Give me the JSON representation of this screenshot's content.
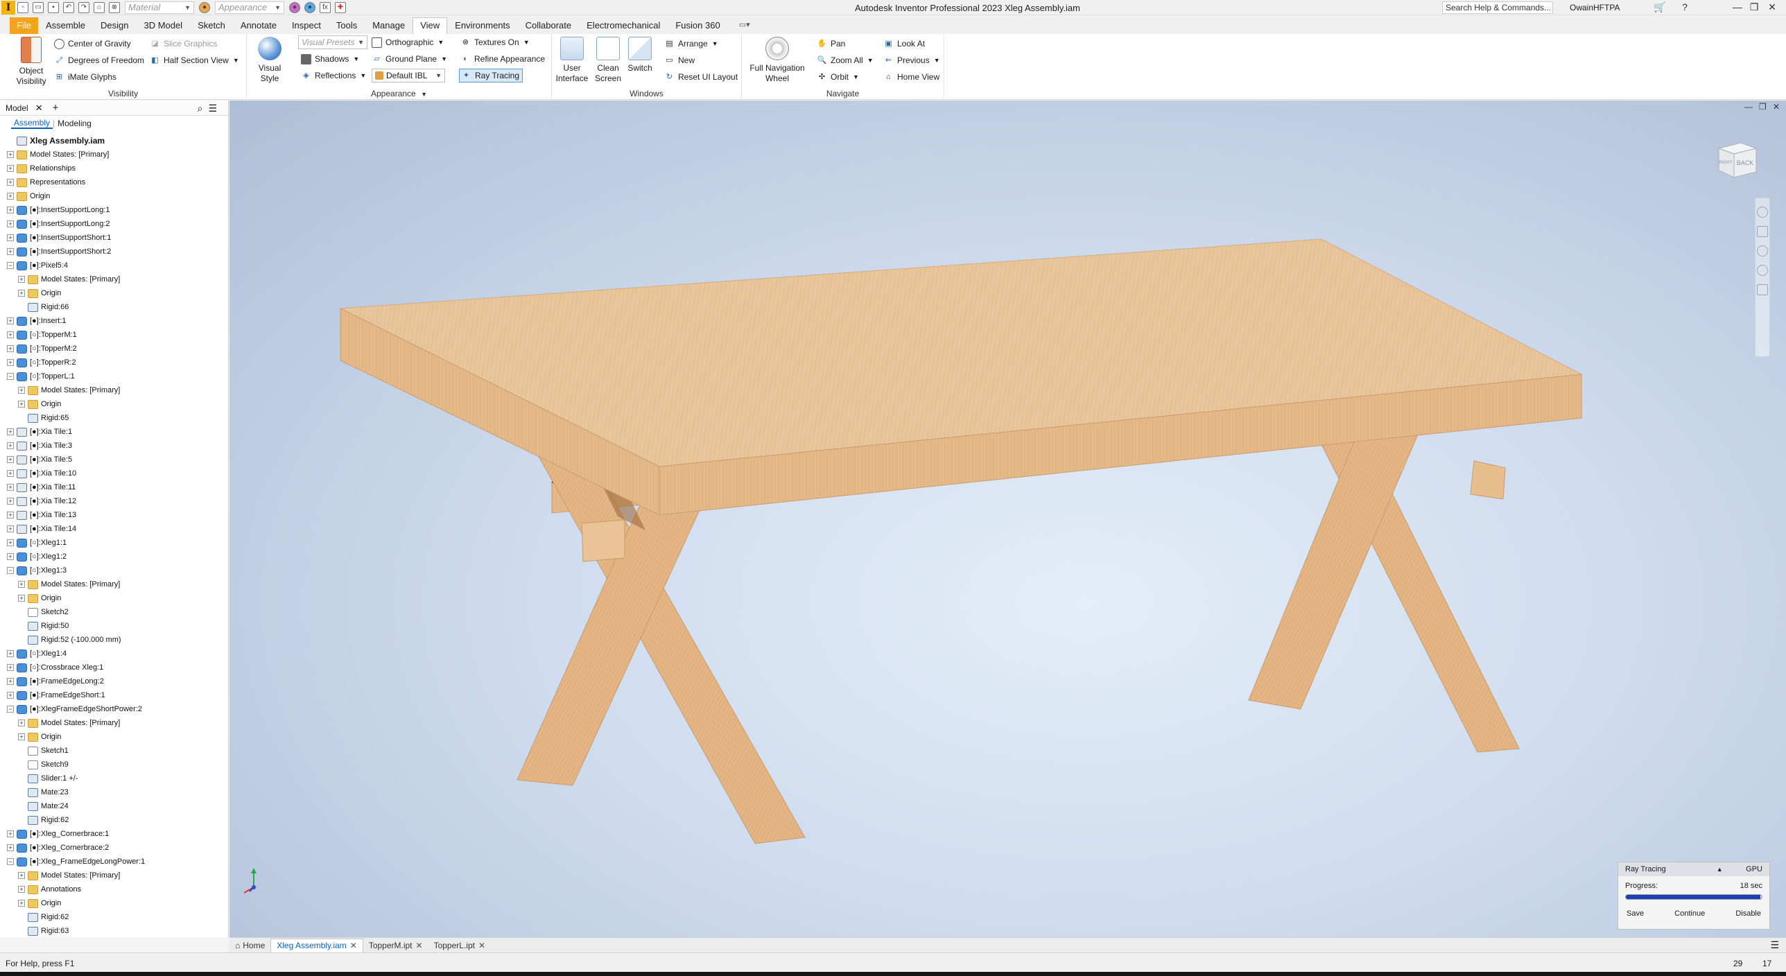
{
  "titlebar": {
    "app_logo": "I",
    "material_placeholder": "Material",
    "appearance_placeholder": "Appearance",
    "fx_label": "fx",
    "title": "Autodesk Inventor Professional 2023    Xleg Assembly.iam",
    "help_search": "Search Help & Commands...",
    "user": "OwainHFTPA"
  },
  "ribbon_tabs": [
    "File",
    "Assemble",
    "Design",
    "3D Model",
    "Sketch",
    "Annotate",
    "Inspect",
    "Tools",
    "Manage",
    "View",
    "Environments",
    "Collaborate",
    "Electromechanical",
    "Fusion 360"
  ],
  "active_tab": "View",
  "ribbon": {
    "visibility": {
      "title": "Visibility",
      "object_visibility": "Object Visibility",
      "center_of_gravity": "Center of Gravity",
      "degrees_of_freedom": "Degrees of Freedom",
      "imate_glyphs": "iMate Glyphs",
      "slice_graphics": "Slice Graphics",
      "half_section_view": "Half Section View"
    },
    "appearance": {
      "title": "Appearance",
      "visual_style": "Visual Style",
      "visual_presets": "Visual Presets",
      "orthographic": "Orthographic",
      "shadows": "Shadows",
      "ground_plane": "Ground Plane",
      "reflections": "Reflections",
      "default_ibl": "Default IBL",
      "textures_on": "Textures On",
      "refine_appearance": "Refine Appearance",
      "ray_tracing": "Ray Tracing"
    },
    "windows": {
      "title": "Windows",
      "user_interface": "User Interface",
      "clean_screen": "Clean Screen",
      "switch": "Switch",
      "arrange": "Arrange",
      "new": "New",
      "reset_ui_layout": "Reset UI Layout"
    },
    "navigate": {
      "title": "Navigate",
      "full_navigation_wheel": "Full Navigation Wheel",
      "pan": "Pan",
      "zoom_all": "Zoom All",
      "orbit": "Orbit",
      "look_at": "Look At",
      "previous": "Previous",
      "home_view": "Home View"
    }
  },
  "browser": {
    "title": "Model",
    "subtabs": [
      "Assembly",
      "Modeling"
    ],
    "tree": [
      {
        "label": "Xleg Assembly.iam",
        "level": 0,
        "icon": "asm",
        "exp": "",
        "root": true
      },
      {
        "label": "Model States: [Primary]",
        "level": 0,
        "icon": "folder",
        "exp": "+"
      },
      {
        "label": "Relationships",
        "level": 0,
        "icon": "rel",
        "exp": "+"
      },
      {
        "label": "Representations",
        "level": 0,
        "icon": "folder",
        "exp": "+"
      },
      {
        "label": "Origin",
        "level": 0,
        "icon": "folder",
        "exp": "+"
      },
      {
        "label": "[●]:InsertSupportLong:1",
        "level": 0,
        "icon": "part",
        "exp": "+"
      },
      {
        "label": "[●]:InsertSupportLong:2",
        "level": 0,
        "icon": "part",
        "exp": "+"
      },
      {
        "label": "[●]:InsertSupportShort:1",
        "level": 0,
        "icon": "part",
        "exp": "+"
      },
      {
        "label": "[●]:InsertSupportShort:2",
        "level": 0,
        "icon": "part",
        "exp": "+"
      },
      {
        "label": "[●]:Pixel5:4",
        "level": 0,
        "icon": "part",
        "exp": "−"
      },
      {
        "label": "Model States: [Primary]",
        "level": 1,
        "icon": "folder",
        "exp": "+"
      },
      {
        "label": "Origin",
        "level": 1,
        "icon": "folder",
        "exp": "+"
      },
      {
        "label": "Rigid:66",
        "level": 1,
        "icon": "constraint",
        "exp": ""
      },
      {
        "label": "[●]:Insert:1",
        "level": 0,
        "icon": "part",
        "exp": "+"
      },
      {
        "label": "[○]:TopperM:1",
        "level": 0,
        "icon": "part",
        "exp": "+"
      },
      {
        "label": "[○]:TopperM:2",
        "level": 0,
        "icon": "part",
        "exp": "+"
      },
      {
        "label": "[○]:TopperR:2",
        "level": 0,
        "icon": "part",
        "exp": "+"
      },
      {
        "label": "[○]:TopperL:1",
        "level": 0,
        "icon": "part",
        "exp": "−"
      },
      {
        "label": "Model States: [Primary]",
        "level": 1,
        "icon": "folder",
        "exp": "+"
      },
      {
        "label": "Origin",
        "level": 1,
        "icon": "folder",
        "exp": "+"
      },
      {
        "label": "Rigid:65",
        "level": 1,
        "icon": "constraint",
        "exp": ""
      },
      {
        "label": "[●]:Xia Tile:1",
        "level": 0,
        "icon": "asm",
        "exp": "+"
      },
      {
        "label": "[●]:Xia Tile:3",
        "level": 0,
        "icon": "asm",
        "exp": "+"
      },
      {
        "label": "[●]:Xia Tile:5",
        "level": 0,
        "icon": "asm",
        "exp": "+"
      },
      {
        "label": "[●]:Xia Tile:10",
        "level": 0,
        "icon": "asm",
        "exp": "+"
      },
      {
        "label": "[●]:Xia Tile:11",
        "level": 0,
        "icon": "asm",
        "exp": "+"
      },
      {
        "label": "[●]:Xia Tile:12",
        "level": 0,
        "icon": "asm",
        "exp": "+"
      },
      {
        "label": "[●]:Xia Tile:13",
        "level": 0,
        "icon": "asm",
        "exp": "+"
      },
      {
        "label": "[●]:Xia Tile:14",
        "level": 0,
        "icon": "asm",
        "exp": "+"
      },
      {
        "label": "[○]:Xleg1:1",
        "level": 0,
        "icon": "part",
        "exp": "+"
      },
      {
        "label": "[○]:Xleg1:2",
        "level": 0,
        "icon": "part",
        "exp": "+"
      },
      {
        "label": "[○]:Xleg1:3",
        "level": 0,
        "icon": "part",
        "exp": "−"
      },
      {
        "label": "Model States: [Primary]",
        "level": 1,
        "icon": "folder",
        "exp": "+"
      },
      {
        "label": "Origin",
        "level": 1,
        "icon": "folder",
        "exp": "+"
      },
      {
        "label": "Sketch2",
        "level": 1,
        "icon": "sketch",
        "exp": ""
      },
      {
        "label": "Rigid:50",
        "level": 1,
        "icon": "constraint",
        "exp": ""
      },
      {
        "label": "Rigid:52 (-100.000 mm)",
        "level": 1,
        "icon": "constraint",
        "exp": ""
      },
      {
        "label": "[○]:Xleg1:4",
        "level": 0,
        "icon": "part",
        "exp": "+"
      },
      {
        "label": "[○]:Crossbrace Xleg:1",
        "level": 0,
        "icon": "part",
        "exp": "+"
      },
      {
        "label": "[●]:FrameEdgeLong:2",
        "level": 0,
        "icon": "part",
        "exp": "+"
      },
      {
        "label": "[●]:FrameEdgeShort:1",
        "level": 0,
        "icon": "part",
        "exp": "+"
      },
      {
        "label": "[●]:XlegFrameEdgeShortPower:2",
        "level": 0,
        "icon": "part",
        "exp": "−"
      },
      {
        "label": "Model States: [Primary]",
        "level": 1,
        "icon": "folder",
        "exp": "+"
      },
      {
        "label": "Origin",
        "level": 1,
        "icon": "folder",
        "exp": "+"
      },
      {
        "label": "Sketch1",
        "level": 1,
        "icon": "sketch",
        "exp": ""
      },
      {
        "label": "Sketch9",
        "level": 1,
        "icon": "sketch",
        "exp": ""
      },
      {
        "label": "Slider:1 +/-",
        "level": 1,
        "icon": "constraint",
        "exp": ""
      },
      {
        "label": "Mate:23",
        "level": 1,
        "icon": "constraint",
        "exp": ""
      },
      {
        "label": "Mate:24",
        "level": 1,
        "icon": "constraint",
        "exp": ""
      },
      {
        "label": "Rigid:62",
        "level": 1,
        "icon": "constraint",
        "exp": ""
      },
      {
        "label": "[●]:Xleg_Cornerbrace:1",
        "level": 0,
        "icon": "part",
        "exp": "+"
      },
      {
        "label": "[●]:Xleg_Cornerbrace:2",
        "level": 0,
        "icon": "part",
        "exp": "+"
      },
      {
        "label": "[●]:Xleg_FrameEdgeLongPower:1",
        "level": 0,
        "icon": "part",
        "exp": "−"
      },
      {
        "label": "Model States: [Primary]",
        "level": 1,
        "icon": "folder",
        "exp": "+"
      },
      {
        "label": "Annotations",
        "level": 1,
        "icon": "folder",
        "exp": "+"
      },
      {
        "label": "Origin",
        "level": 1,
        "icon": "folder",
        "exp": "+"
      },
      {
        "label": "Rigid:62",
        "level": 1,
        "icon": "constraint",
        "exp": ""
      },
      {
        "label": "Rigid:63",
        "level": 1,
        "icon": "constraint",
        "exp": ""
      }
    ]
  },
  "viewcube": {
    "face_label": "BACK",
    "side_label": "RIGHT"
  },
  "ray_tracing": {
    "title": "Ray Tracing",
    "gpu": "GPU",
    "progress_label": "Progress:",
    "time": "18 sec",
    "progress_fraction": 0.99,
    "save": "Save",
    "continue": "Continue",
    "disable": "Disable"
  },
  "doc_tabs": [
    {
      "label": "Home",
      "active": false,
      "close": false
    },
    {
      "label": "Xleg Assembly.iam",
      "active": true,
      "close": true
    },
    {
      "label": "TopperM.ipt",
      "active": false,
      "close": true
    },
    {
      "label": "TopperL.ipt",
      "active": false,
      "close": true
    }
  ],
  "status": {
    "help": "For Help, press F1",
    "num1": "29",
    "num2": "17"
  },
  "colors": {
    "wood_top": "#e9c499",
    "wood_side": "#e6b98a",
    "wood_leg": "#e2b282",
    "ribbon_accent": "#f4a11d"
  }
}
